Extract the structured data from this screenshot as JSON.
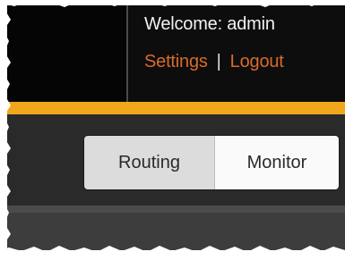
{
  "header": {
    "welcome_text": "Welcome: admin",
    "links": {
      "settings_label": "Settings",
      "separator": "|",
      "logout_label": "Logout"
    }
  },
  "nav": {
    "tabs": [
      {
        "label": "Routing",
        "active": true
      },
      {
        "label": "Monitor",
        "active": false
      }
    ]
  },
  "colors": {
    "header_bg": "#0d0d0d",
    "accent": "#f0a81a",
    "link": "#d86a2c",
    "nav_bg": "#2a2a2a"
  }
}
